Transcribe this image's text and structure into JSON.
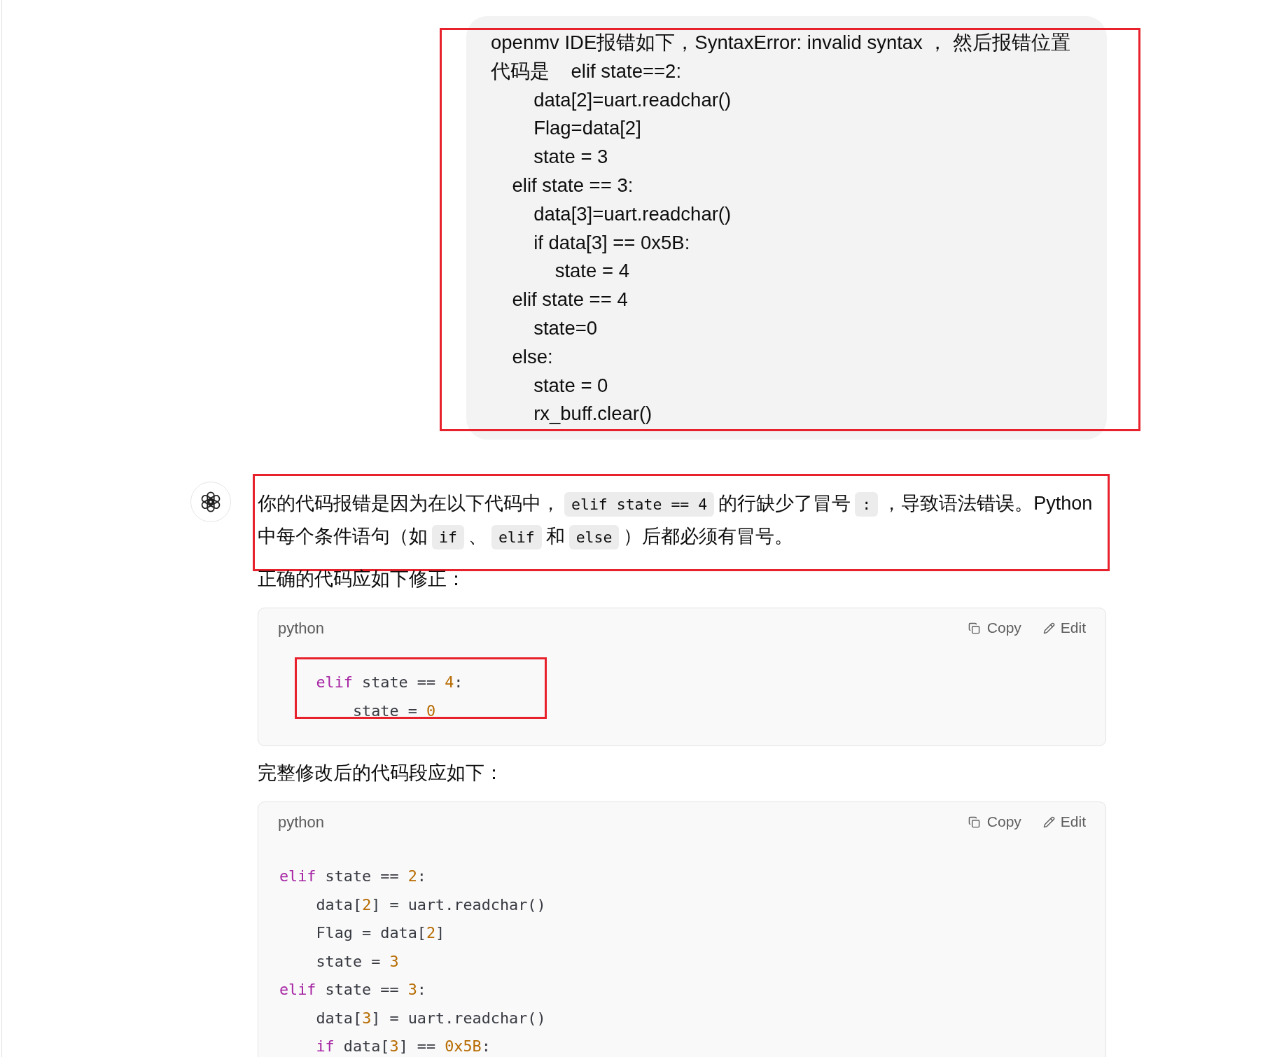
{
  "user_message": {
    "highlighted": true,
    "lines": [
      "openmv IDE报错如下，SyntaxError: invalid syntax ， 然后报错位置",
      "代码是    elif state==2:",
      "        data[2]=uart.readchar()",
      "        Flag=data[2]",
      "        state = 3",
      "    elif state == 3:",
      "        data[3]=uart.readchar()",
      "        if data[3] == 0x5B:",
      "            state = 4",
      "    elif state == 4",
      "        state=0",
      "    else:",
      "        state = 0",
      "        rx_buff.clear()"
    ]
  },
  "assistant_message": {
    "content": [
      {
        "kind": "paragraph",
        "highlighted": true,
        "segments": [
          {
            "kind": "text",
            "text": "你的代码报错是因为在以下代码中，"
          },
          {
            "kind": "code",
            "text": "elif state == 4"
          },
          {
            "kind": "text",
            "text": "的行缺少了冒号"
          },
          {
            "kind": "code",
            "text": ":"
          },
          {
            "kind": "text",
            "text": "，导致语法错误。Python中每个条件语句（如"
          },
          {
            "kind": "code",
            "text": "if"
          },
          {
            "kind": "text",
            "text": "、"
          },
          {
            "kind": "code",
            "text": "elif"
          },
          {
            "kind": "text",
            "text": "和"
          },
          {
            "kind": "code",
            "text": "else"
          },
          {
            "kind": "text",
            "text": "）后都必须有冒号。"
          }
        ]
      },
      {
        "kind": "paragraph",
        "highlighted": false,
        "segments": [
          {
            "kind": "text",
            "text": "正确的代码应如下修正："
          }
        ]
      },
      {
        "kind": "code_block",
        "highlighted": true,
        "language": "python",
        "copy_label": "Copy",
        "edit_label": "Edit",
        "lines": [
          [
            {
              "kind": "keyword",
              "text": "    elif"
            },
            {
              "kind": "plain",
              "text": " state == "
            },
            {
              "kind": "number",
              "text": "4"
            },
            {
              "kind": "plain",
              "text": ":"
            }
          ],
          [
            {
              "kind": "plain",
              "text": "        state = "
            },
            {
              "kind": "number",
              "text": "0"
            }
          ]
        ]
      },
      {
        "kind": "paragraph",
        "highlighted": false,
        "segments": [
          {
            "kind": "text",
            "text": "完整修改后的代码段应如下："
          }
        ]
      },
      {
        "kind": "code_block",
        "highlighted": false,
        "language": "python",
        "copy_label": "Copy",
        "edit_label": "Edit",
        "lines": [
          [
            {
              "kind": "keyword",
              "text": "elif"
            },
            {
              "kind": "plain",
              "text": " state == "
            },
            {
              "kind": "number",
              "text": "2"
            },
            {
              "kind": "plain",
              "text": ":"
            }
          ],
          [
            {
              "kind": "plain",
              "text": "    data["
            },
            {
              "kind": "number",
              "text": "2"
            },
            {
              "kind": "plain",
              "text": "] = uart.readchar()"
            }
          ],
          [
            {
              "kind": "plain",
              "text": "    Flag = data["
            },
            {
              "kind": "number",
              "text": "2"
            },
            {
              "kind": "plain",
              "text": "]"
            }
          ],
          [
            {
              "kind": "plain",
              "text": "    state = "
            },
            {
              "kind": "number",
              "text": "3"
            }
          ],
          [
            {
              "kind": "keyword",
              "text": "elif"
            },
            {
              "kind": "plain",
              "text": " state == "
            },
            {
              "kind": "number",
              "text": "3"
            },
            {
              "kind": "plain",
              "text": ":"
            }
          ],
          [
            {
              "kind": "plain",
              "text": "    data["
            },
            {
              "kind": "number",
              "text": "3"
            },
            {
              "kind": "plain",
              "text": "] = uart.readchar()"
            }
          ],
          [
            {
              "kind": "keyword",
              "text": "    if"
            },
            {
              "kind": "plain",
              "text": " data["
            },
            {
              "kind": "number",
              "text": "3"
            },
            {
              "kind": "plain",
              "text": "] == "
            },
            {
              "kind": "number",
              "text": "0x5B"
            },
            {
              "kind": "plain",
              "text": ":"
            }
          ]
        ]
      }
    ]
  }
}
